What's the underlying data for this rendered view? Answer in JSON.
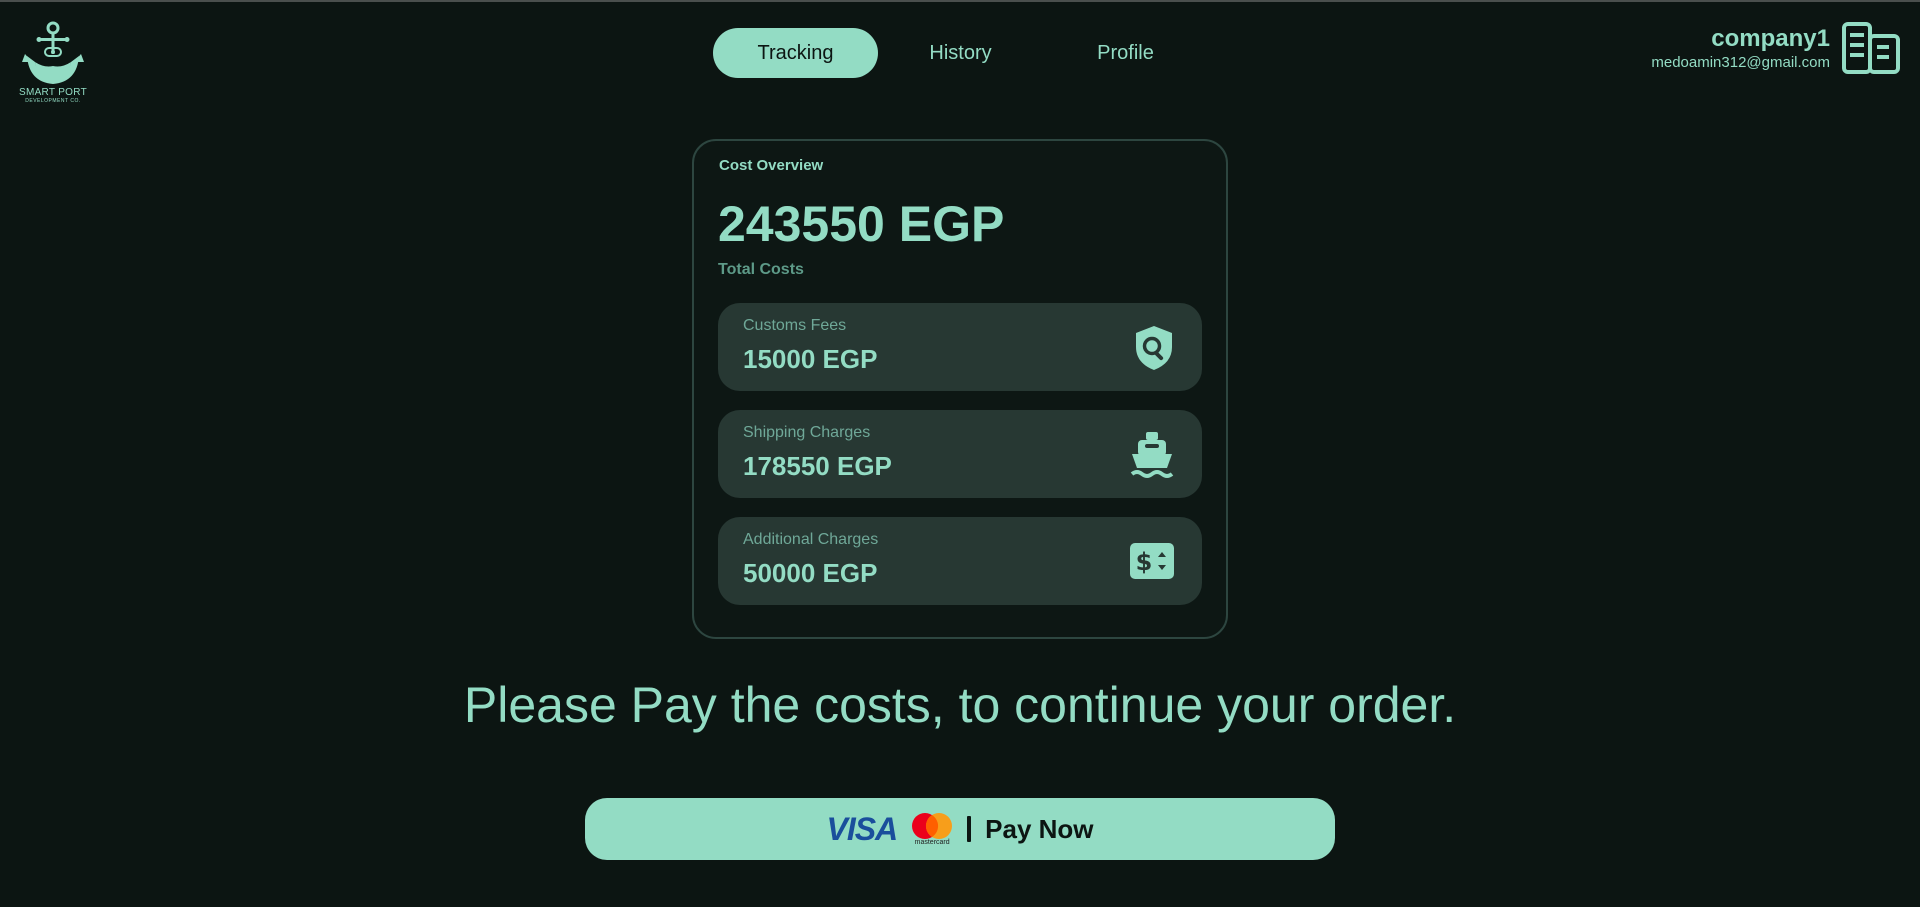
{
  "brand": {
    "name": "SMART PORT",
    "subtitle": "DEVELOPMENT CO."
  },
  "nav": {
    "items": [
      {
        "label": "Tracking",
        "active": true
      },
      {
        "label": "History",
        "active": false
      },
      {
        "label": "Profile",
        "active": false
      }
    ]
  },
  "user": {
    "name": "company1",
    "email": "medoamin312@gmail.com",
    "icon": "building-icon"
  },
  "cost_overview": {
    "title": "Cost Overview",
    "total_value": "243550 EGP",
    "total_label": "Total Costs",
    "rows": [
      {
        "label": "Customs Fees",
        "value": "15000 EGP",
        "icon": "shield-search-icon"
      },
      {
        "label": "Shipping Charges",
        "value": "178550 EGP",
        "icon": "ship-icon"
      },
      {
        "label": "Additional Charges",
        "value": "50000 EGP",
        "icon": "dollar-sort-icon"
      }
    ]
  },
  "message": "Please Pay the costs, to continue your order.",
  "payment": {
    "visa_label": "VISA",
    "mastercard_label": "mastercard",
    "button_label": "Pay Now"
  },
  "colors": {
    "background": "#0c1512",
    "accent": "#93dcc4",
    "card_row": "#273833"
  }
}
